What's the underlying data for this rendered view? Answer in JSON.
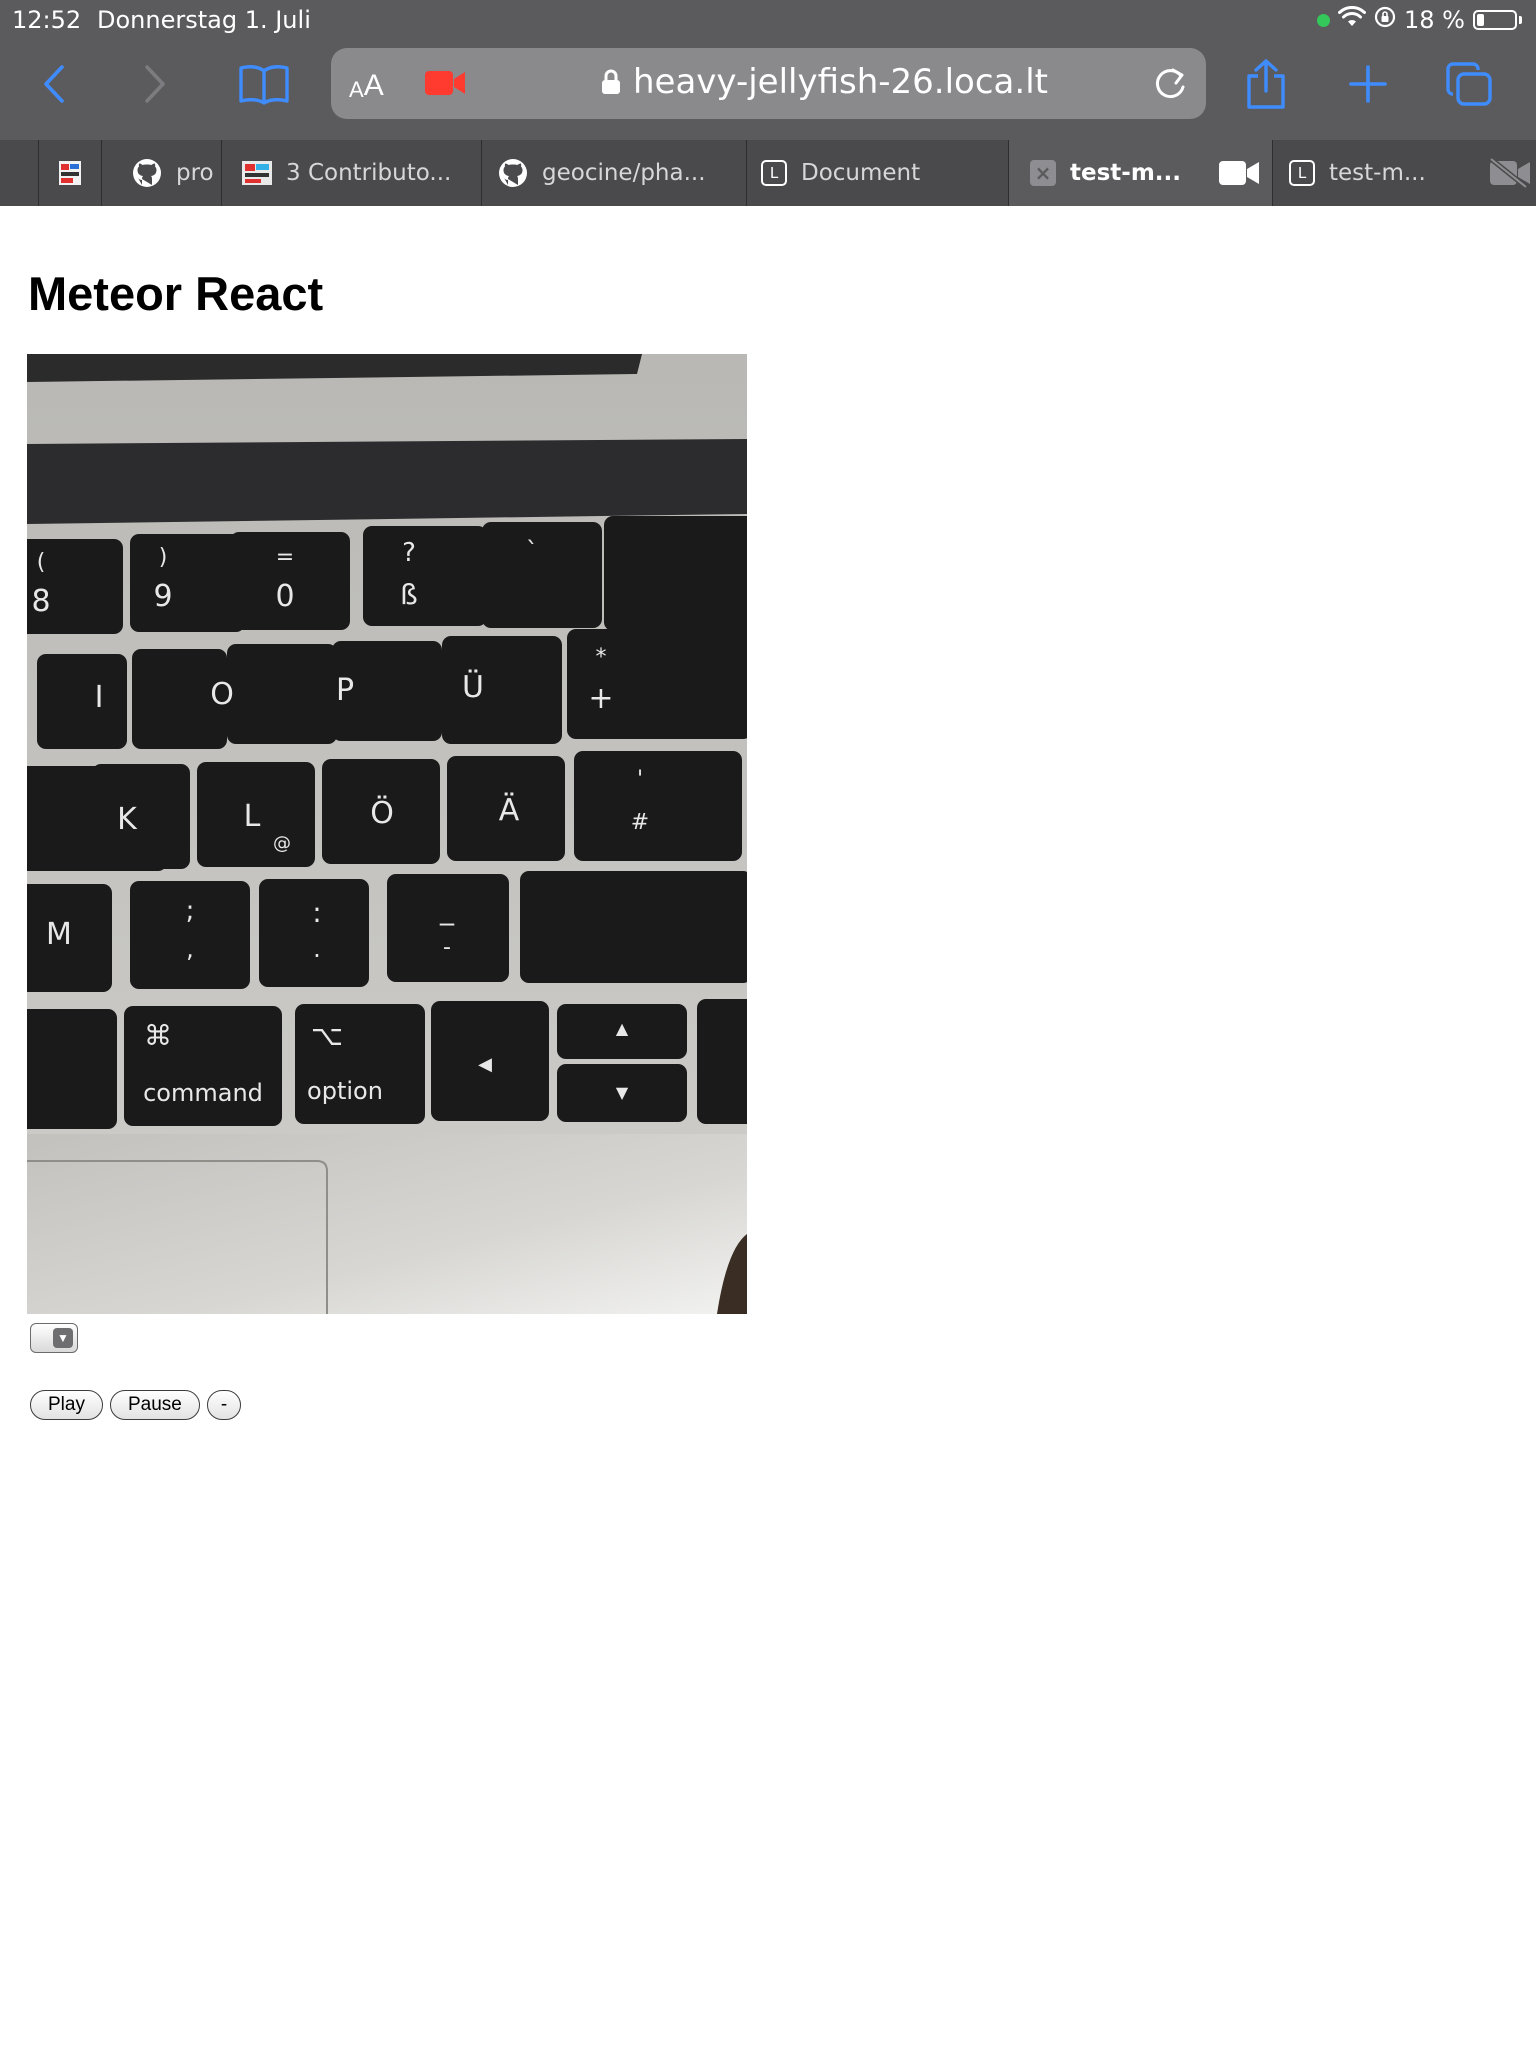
{
  "status_bar": {
    "time": "12:52",
    "date": "Donnerstag 1. Juli",
    "battery_text": "18 %",
    "camera_in_use_color": "#34c759"
  },
  "toolbar": {
    "back_icon": "chevron-left-icon",
    "forward_icon": "chevron-right-icon",
    "bookmarks_icon": "book-icon",
    "aa_small": "A",
    "aa_big": "A",
    "url": "heavy-jellyfish-26.loca.lt",
    "share_icon": "share-icon",
    "new_tab_icon": "plus-icon",
    "tabs_icon": "tabs-overview-icon",
    "accent_color": "#3478f6",
    "recording_color": "#ff3b30"
  },
  "tabs": [
    {
      "label": "pro",
      "icon": "github-icon"
    },
    {
      "label": "3 Contributo...",
      "icon": "favicon"
    },
    {
      "label": "geocine/pha...",
      "icon": "github-icon"
    },
    {
      "label": "Document",
      "icon": "l-badge"
    },
    {
      "label": "test-m...",
      "icon": "close-icon",
      "active": true
    },
    {
      "label": "test-m...",
      "icon": "l-badge"
    }
  ],
  "page": {
    "title": "Meteor React",
    "video_description_icon": "camera-feed",
    "select_value": "",
    "buttons": {
      "play": "Play",
      "pause": "Pause",
      "minus": "-"
    }
  },
  "keyboard_labels": {
    "row1": [
      "(",
      "8",
      ")",
      "9",
      "=",
      "0",
      "?",
      "ß",
      "`"
    ],
    "row2": [
      "I",
      "O",
      "P",
      "Ü",
      "*",
      "+"
    ],
    "row3": [
      "K",
      "L",
      "@",
      "Ö",
      "Ä",
      "'",
      "#"
    ],
    "row4": [
      "M",
      ";",
      ",",
      ":",
      ".",
      "_",
      "-"
    ],
    "row5": [
      "⌘",
      "command",
      "⌥",
      "option",
      "◀",
      "▲",
      "▼"
    ]
  }
}
